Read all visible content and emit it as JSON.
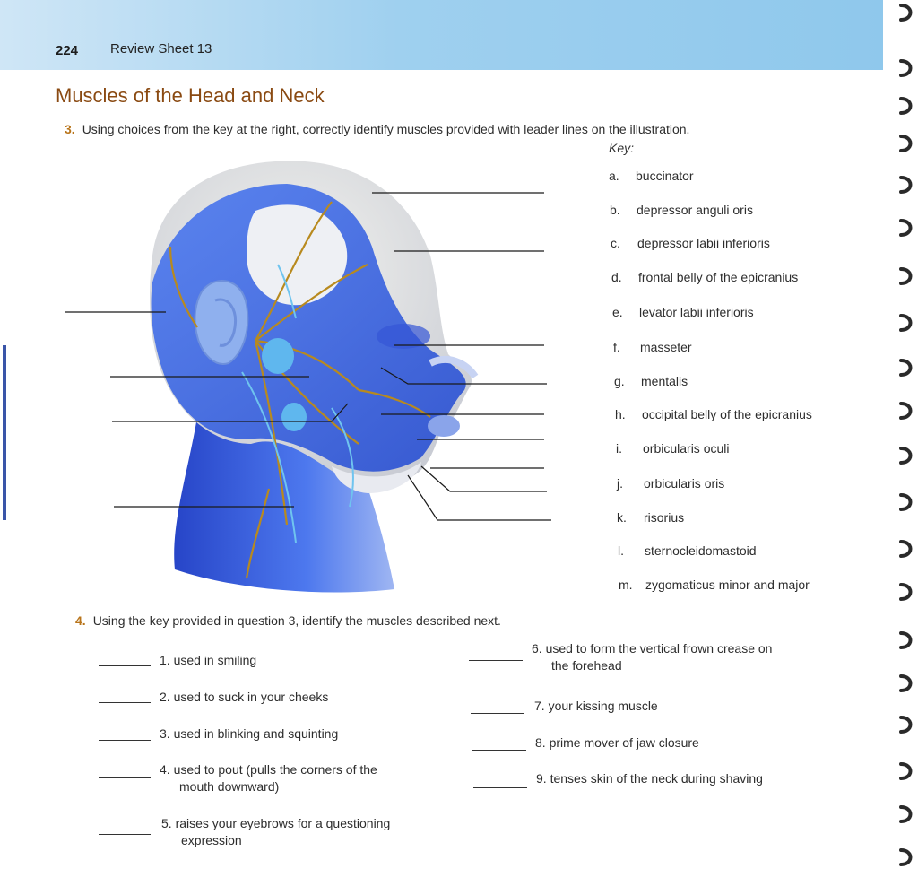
{
  "header": {
    "page_number": "224",
    "running_head": "Review Sheet 13"
  },
  "section_title": "Muscles of the Head and Neck",
  "question3": {
    "number": "3.",
    "text": "Using choices from the key at the right, correctly identify muscles provided with leader lines on the illustration."
  },
  "key": {
    "title": "Key:",
    "items": [
      {
        "letter": "a.",
        "label": "buccinator"
      },
      {
        "letter": "b.",
        "label": "depressor anguli oris"
      },
      {
        "letter": "c.",
        "label": "depressor labii inferioris"
      },
      {
        "letter": "d.",
        "label": "frontal belly of the epicranius"
      },
      {
        "letter": "e.",
        "label": "levator labii inferioris"
      },
      {
        "letter": "f.",
        "label": "masseter"
      },
      {
        "letter": "g.",
        "label": "mentalis"
      },
      {
        "letter": "h.",
        "label": "occipital belly of the epicranius"
      },
      {
        "letter": "i.",
        "label": "orbicularis oculi"
      },
      {
        "letter": "j.",
        "label": "orbicularis oris"
      },
      {
        "letter": "k.",
        "label": "risorius"
      },
      {
        "letter": "l.",
        "label": "sternocleidomastoid"
      },
      {
        "letter": "m.",
        "label": "zygomaticus minor and major"
      }
    ]
  },
  "question4": {
    "number": "4.",
    "text": "Using the key provided in question 3, identify the muscles described next.",
    "items": [
      {
        "text": "1. used in smiling"
      },
      {
        "text": "2. used to suck in your cheeks"
      },
      {
        "text": "3. used in blinking and squinting"
      },
      {
        "line1": "4. used to pout (pulls the corners of the",
        "line2": "mouth downward)"
      },
      {
        "line1": "5. raises your eyebrows for a questioning",
        "line2": "expression"
      },
      {
        "line1": "6. used to form the vertical frown crease on",
        "line2": "the forehead"
      },
      {
        "text": "7. your kissing muscle"
      },
      {
        "text": "8. prime mover of jaw closure"
      },
      {
        "text": "9. tenses skin of the neck during shaving"
      }
    ]
  },
  "colors": {
    "header_band": "#9fd0ef",
    "title_brown": "#8a4a12",
    "question_number_orange": "#b8741a",
    "muscle_blue": "#3b63e0",
    "nerve_gold": "#b88a1e"
  }
}
